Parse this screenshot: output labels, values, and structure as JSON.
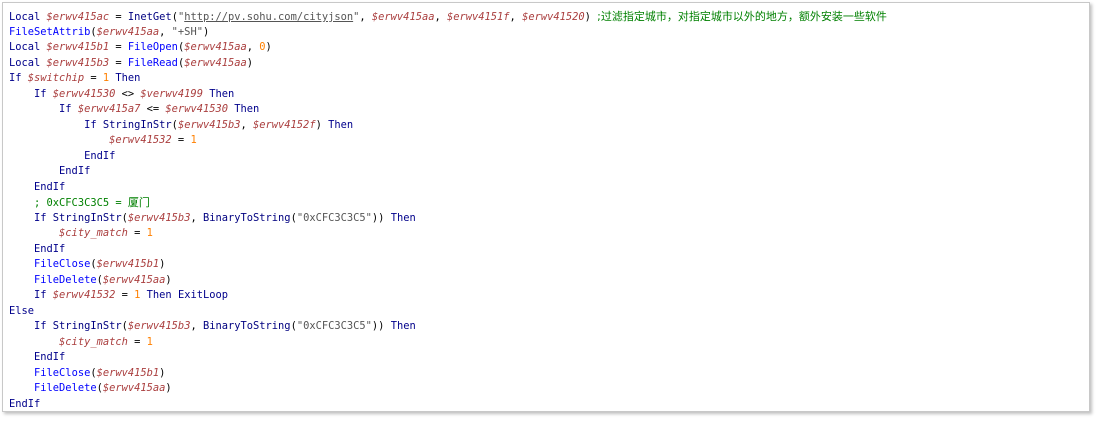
{
  "code": {
    "lines": [
      [
        {
          "t": "Local ",
          "c": "kw"
        },
        {
          "t": "$erwv415ac",
          "c": "var"
        },
        {
          "t": " = ",
          "c": "op"
        },
        {
          "t": "InetGet",
          "c": "fn"
        },
        {
          "t": "(",
          "c": "op"
        },
        {
          "t": "\"",
          "c": "str"
        },
        {
          "t": "http://pv.sohu.com/cityjson",
          "c": "url"
        },
        {
          "t": "\"",
          "c": "str"
        },
        {
          "t": ", ",
          "c": "op"
        },
        {
          "t": "$erwv415aa",
          "c": "var"
        },
        {
          "t": ", ",
          "c": "op"
        },
        {
          "t": "$erwv4151f",
          "c": "var"
        },
        {
          "t": ", ",
          "c": "op"
        },
        {
          "t": "$erwv41520",
          "c": "var"
        },
        {
          "t": ") ",
          "c": "op"
        },
        {
          "t": ";过滤指定城市，对指定城市以外的地方，额外安装一些软件",
          "c": "cmt"
        }
      ],
      [
        {
          "t": "FileSetAttrib",
          "c": "ufn"
        },
        {
          "t": "(",
          "c": "op"
        },
        {
          "t": "$erwv415aa",
          "c": "var"
        },
        {
          "t": ", ",
          "c": "op"
        },
        {
          "t": "\"+SH\"",
          "c": "str"
        },
        {
          "t": ")",
          "c": "op"
        }
      ],
      [
        {
          "t": "Local ",
          "c": "kw"
        },
        {
          "t": "$erwv415b1",
          "c": "var"
        },
        {
          "t": " = ",
          "c": "op"
        },
        {
          "t": "FileOpen",
          "c": "ufn"
        },
        {
          "t": "(",
          "c": "op"
        },
        {
          "t": "$erwv415aa",
          "c": "var"
        },
        {
          "t": ", ",
          "c": "op"
        },
        {
          "t": "0",
          "c": "num"
        },
        {
          "t": ")",
          "c": "op"
        }
      ],
      [
        {
          "t": "Local ",
          "c": "kw"
        },
        {
          "t": "$erwv415b3",
          "c": "var"
        },
        {
          "t": " = ",
          "c": "op"
        },
        {
          "t": "FileRead",
          "c": "ufn"
        },
        {
          "t": "(",
          "c": "op"
        },
        {
          "t": "$erwv415aa",
          "c": "var"
        },
        {
          "t": ")",
          "c": "op"
        }
      ],
      [
        {
          "t": "If ",
          "c": "kw"
        },
        {
          "t": "$switchip",
          "c": "var"
        },
        {
          "t": " = ",
          "c": "op"
        },
        {
          "t": "1",
          "c": "num"
        },
        {
          "t": " Then",
          "c": "kw"
        }
      ],
      [
        {
          "t": "    If ",
          "c": "kw"
        },
        {
          "t": "$erwv41530",
          "c": "var"
        },
        {
          "t": " <> ",
          "c": "op"
        },
        {
          "t": "$verwv4199",
          "c": "var"
        },
        {
          "t": " Then",
          "c": "kw"
        }
      ],
      [
        {
          "t": "        If ",
          "c": "kw"
        },
        {
          "t": "$erwv415a7",
          "c": "var"
        },
        {
          "t": " <= ",
          "c": "op"
        },
        {
          "t": "$erwv41530",
          "c": "var"
        },
        {
          "t": " Then",
          "c": "kw"
        }
      ],
      [
        {
          "t": "            If ",
          "c": "kw"
        },
        {
          "t": "StringInStr",
          "c": "fn"
        },
        {
          "t": "(",
          "c": "op"
        },
        {
          "t": "$erwv415b3",
          "c": "var"
        },
        {
          "t": ", ",
          "c": "op"
        },
        {
          "t": "$erwv4152f",
          "c": "var"
        },
        {
          "t": ") ",
          "c": "op"
        },
        {
          "t": "Then",
          "c": "kw"
        }
      ],
      [
        {
          "t": "                ",
          "c": "op"
        },
        {
          "t": "$erwv41532",
          "c": "var"
        },
        {
          "t": " = ",
          "c": "op"
        },
        {
          "t": "1",
          "c": "num"
        }
      ],
      [
        {
          "t": "            EndIf",
          "c": "kw"
        }
      ],
      [
        {
          "t": "        EndIf",
          "c": "kw"
        }
      ],
      [
        {
          "t": "    EndIf",
          "c": "kw"
        }
      ],
      [
        {
          "t": "    ; 0xCFC3C3C5 = ",
          "c": "cmt-mono"
        },
        {
          "t": "厦门",
          "c": "cmt"
        }
      ],
      [
        {
          "t": "    If ",
          "c": "kw"
        },
        {
          "t": "StringInStr",
          "c": "fn"
        },
        {
          "t": "(",
          "c": "op"
        },
        {
          "t": "$erwv415b3",
          "c": "var"
        },
        {
          "t": ", ",
          "c": "op"
        },
        {
          "t": "BinaryToString",
          "c": "fn"
        },
        {
          "t": "(",
          "c": "op"
        },
        {
          "t": "\"0xCFC3C3C5\"",
          "c": "str"
        },
        {
          "t": ")) ",
          "c": "op"
        },
        {
          "t": "Then",
          "c": "kw"
        }
      ],
      [
        {
          "t": "        ",
          "c": "op"
        },
        {
          "t": "$city_match",
          "c": "var"
        },
        {
          "t": " = ",
          "c": "op"
        },
        {
          "t": "1",
          "c": "num"
        }
      ],
      [
        {
          "t": "    EndIf",
          "c": "kw"
        }
      ],
      [
        {
          "t": "    ",
          "c": "op"
        },
        {
          "t": "FileClose",
          "c": "ufn"
        },
        {
          "t": "(",
          "c": "op"
        },
        {
          "t": "$erwv415b1",
          "c": "var"
        },
        {
          "t": ")",
          "c": "op"
        }
      ],
      [
        {
          "t": "    ",
          "c": "op"
        },
        {
          "t": "FileDelete",
          "c": "ufn"
        },
        {
          "t": "(",
          "c": "op"
        },
        {
          "t": "$erwv415aa",
          "c": "var"
        },
        {
          "t": ")",
          "c": "op"
        }
      ],
      [
        {
          "t": "    If ",
          "c": "kw"
        },
        {
          "t": "$erwv41532",
          "c": "var"
        },
        {
          "t": " = ",
          "c": "op"
        },
        {
          "t": "1",
          "c": "num"
        },
        {
          "t": " Then ExitLoop",
          "c": "kw"
        }
      ],
      [
        {
          "t": "Else",
          "c": "kw"
        }
      ],
      [
        {
          "t": "    If ",
          "c": "kw"
        },
        {
          "t": "StringInStr",
          "c": "fn"
        },
        {
          "t": "(",
          "c": "op"
        },
        {
          "t": "$erwv415b3",
          "c": "var"
        },
        {
          "t": ", ",
          "c": "op"
        },
        {
          "t": "BinaryToString",
          "c": "fn"
        },
        {
          "t": "(",
          "c": "op"
        },
        {
          "t": "\"0xCFC3C3C5\"",
          "c": "str"
        },
        {
          "t": ")) ",
          "c": "op"
        },
        {
          "t": "Then",
          "c": "kw"
        }
      ],
      [
        {
          "t": "        ",
          "c": "op"
        },
        {
          "t": "$city_match",
          "c": "var"
        },
        {
          "t": " = ",
          "c": "op"
        },
        {
          "t": "1",
          "c": "num"
        }
      ],
      [
        {
          "t": "    EndIf",
          "c": "kw"
        }
      ],
      [
        {
          "t": "    ",
          "c": "op"
        },
        {
          "t": "FileClose",
          "c": "ufn"
        },
        {
          "t": "(",
          "c": "op"
        },
        {
          "t": "$erwv415b1",
          "c": "var"
        },
        {
          "t": ")",
          "c": "op"
        }
      ],
      [
        {
          "t": "    ",
          "c": "op"
        },
        {
          "t": "FileDelete",
          "c": "ufn"
        },
        {
          "t": "(",
          "c": "op"
        },
        {
          "t": "$erwv415aa",
          "c": "var"
        },
        {
          "t": ")",
          "c": "op"
        }
      ],
      [
        {
          "t": "EndIf",
          "c": "kw"
        }
      ]
    ]
  }
}
